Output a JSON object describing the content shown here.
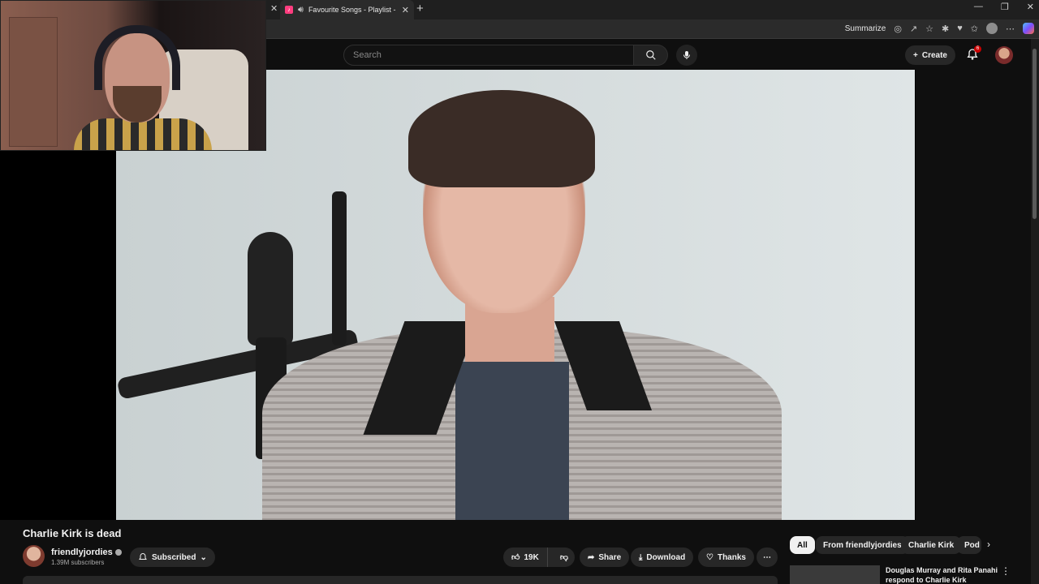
{
  "browser": {
    "tab_title": "Favourite Songs - Playlist - A",
    "summarize_label": "Summarize"
  },
  "header": {
    "search_placeholder": "Search",
    "create_label": "Create",
    "notification_count": "6"
  },
  "video": {
    "title": "Charlie Kirk is dead",
    "channel_name": "friendlyjordies",
    "subscribers": "1.39M subscribers",
    "subscribed_label": "Subscribed",
    "likes": "19K",
    "share_label": "Share",
    "download_label": "Download",
    "thanks_label": "Thanks"
  },
  "rail": {
    "chips": [
      "All",
      "From friendlyjordies",
      "Charlie Kirk",
      "Pod"
    ],
    "recommendation_title": "Douglas Murray and Rita Panahi respond to Charlie Kirk"
  },
  "colors": {
    "background": "#0f0f0f",
    "chip_active": "#f1f1f1",
    "notification": "#cc0000",
    "tab_favicon": "#ff3d7f"
  }
}
